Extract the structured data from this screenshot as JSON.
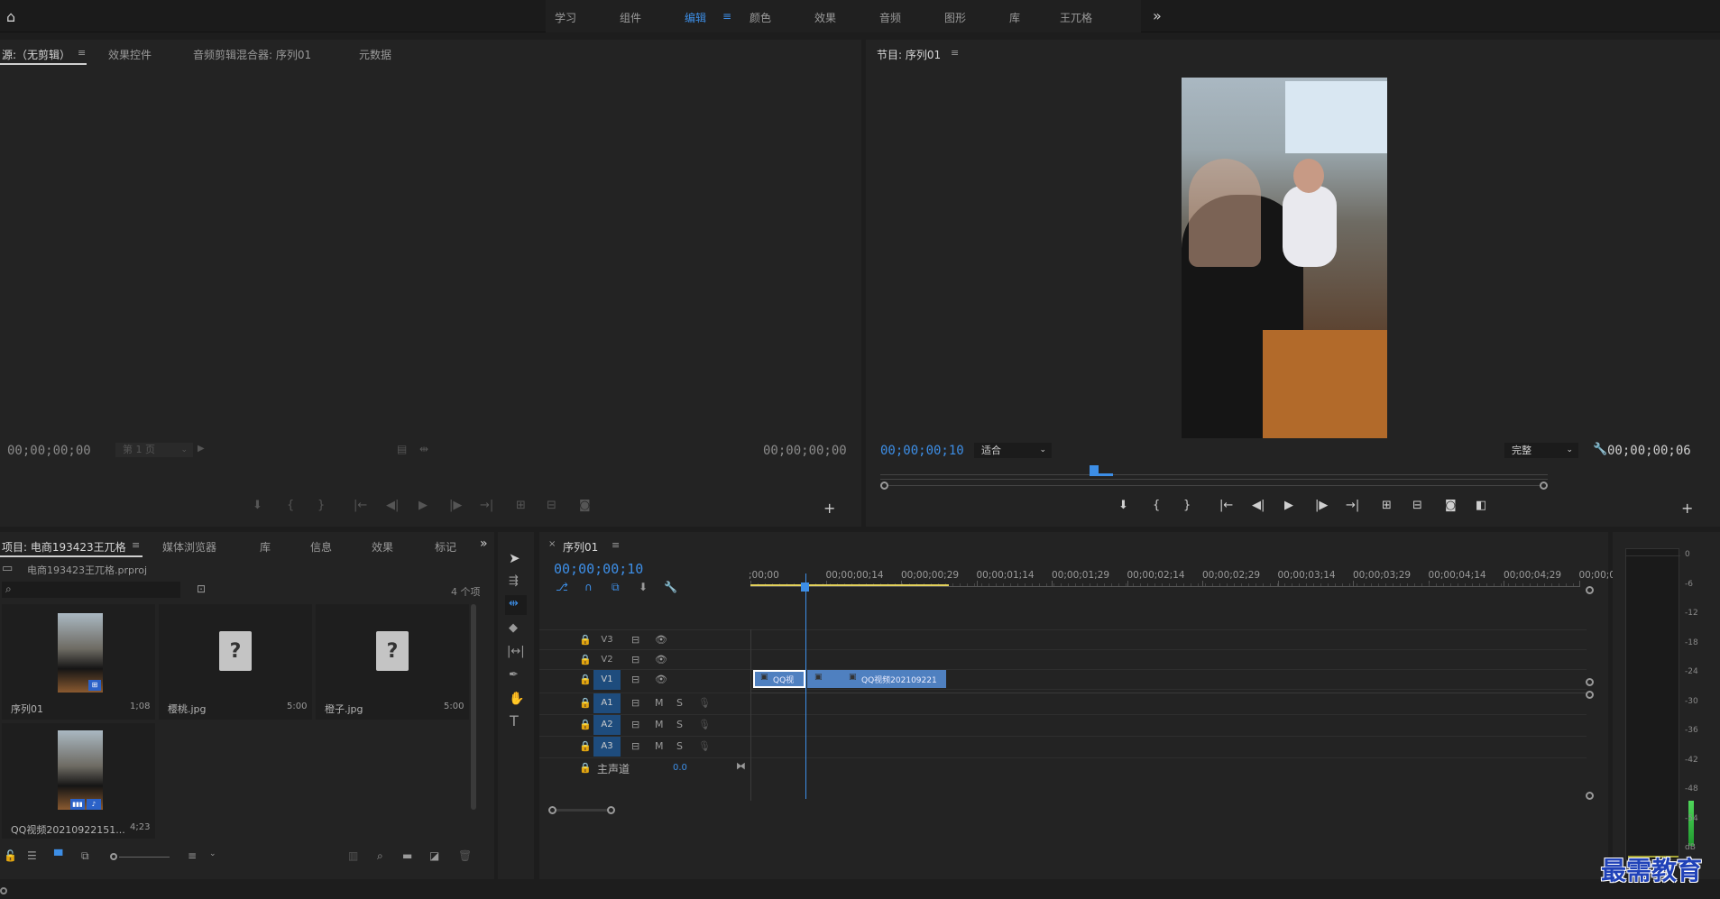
{
  "workspaces": {
    "items": [
      "学习",
      "组件",
      "编辑",
      "颜色",
      "效果",
      "音频",
      "图形",
      "库",
      "王兀格"
    ],
    "more": "»"
  },
  "source_panel": {
    "tabs": [
      "源:（无剪辑）",
      "效果控件",
      "音频剪辑混合器: 序列01",
      "元数据"
    ],
    "tc_left": "00;00;00;00",
    "page_select": "第 1 页",
    "tc_right": "00;00;00;00"
  },
  "program_panel": {
    "title": "节目: 序列01",
    "tc_current": "00;00;00;10",
    "zoom": "适合",
    "quality": "完整",
    "tc_duration": "00;00;00;06"
  },
  "project_panel": {
    "tabs": [
      "项目: 电商193423王兀格",
      "媒体浏览器",
      "库",
      "信息",
      "效果",
      "标记"
    ],
    "file": "电商193423王兀格.prproj",
    "count": "4 个项",
    "items": [
      {
        "name": "序列01",
        "dur": "1;08"
      },
      {
        "name": "樱桃.jpg",
        "dur": "5:00"
      },
      {
        "name": "橙子.jpg",
        "dur": "5:00"
      },
      {
        "name": "QQ视频20210922151...",
        "dur": "4;23"
      }
    ],
    "unknown_glyph": "?"
  },
  "timeline": {
    "title": "序列01",
    "tc": "00;00;00;10",
    "ruler": [
      ";00;00",
      "00;00;00;14",
      "00;00;00;29",
      "00;00;01;14",
      "00;00;01;29",
      "00;00;02;14",
      "00;00;02;29",
      "00;00;03;14",
      "00;00;03;29",
      "00;00;04;14",
      "00;00;04;29",
      "00;00;0"
    ],
    "video_tracks": [
      "V3",
      "V2",
      "V1"
    ],
    "audio_tracks": [
      "A1",
      "A2",
      "A3"
    ],
    "mute": "M",
    "solo": "S",
    "master": "主声道",
    "master_val": "0.0",
    "clip1": "QQ视",
    "clip2": "QQ视频202109221"
  },
  "meter": {
    "labels": [
      "0",
      "-6",
      "-12",
      "-18",
      "-24",
      "-30",
      "-36",
      "-42",
      "-48",
      "-54",
      "dB"
    ]
  },
  "watermark": "最需教育"
}
